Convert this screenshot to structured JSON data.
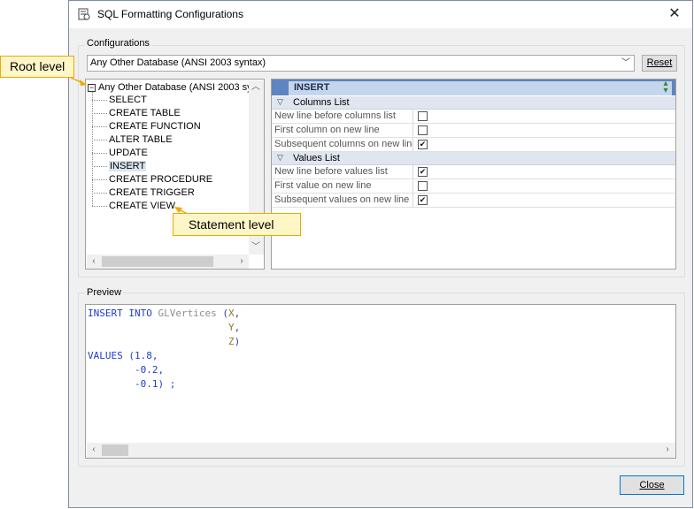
{
  "window": {
    "title": "SQL Formatting Configurations",
    "close_glyph": "✕"
  },
  "configurations": {
    "group_label": "Configurations",
    "combo_value": "Any Other Database (ANSI 2003 syntax)",
    "reset_label": "Reset"
  },
  "tree": {
    "root": "Any Other Database (ANSI 2003 sy",
    "items": [
      "SELECT",
      "CREATE TABLE",
      "CREATE FUNCTION",
      "ALTER TABLE",
      "UPDATE",
      "INSERT",
      "CREATE PROCEDURE",
      "CREATE TRIGGER",
      "CREATE VIEW"
    ],
    "selected": "INSERT"
  },
  "grid": {
    "title": "INSERT",
    "categories": [
      {
        "label": "Columns List",
        "props": [
          {
            "name": "New line before columns list",
            "checked": false
          },
          {
            "name": "First column on new line",
            "checked": false
          },
          {
            "name": "Subsequent columns on new line",
            "checked": true
          }
        ]
      },
      {
        "label": "Values List",
        "props": [
          {
            "name": "New line before values list",
            "checked": true
          },
          {
            "name": "First value on new line",
            "checked": false
          },
          {
            "name": "Subsequent values on new line",
            "checked": true
          }
        ]
      }
    ]
  },
  "preview": {
    "group_label": "Preview",
    "code": {
      "insert_kw": "INSERT INTO",
      "table": "GLVertices",
      "cols": [
        "X",
        "Y",
        "Z"
      ],
      "values_kw": "VALUES",
      "values": [
        "1.8",
        "-0.2",
        "-0.1"
      ]
    }
  },
  "close_label": "Close",
  "callouts": {
    "root": "Root level",
    "statement": "Statement level"
  },
  "colors": {
    "accent": "#5e84c2",
    "callout_bg": "#fff6c8",
    "callout_border": "#f0a800",
    "keyword": "#1d3ecb"
  }
}
